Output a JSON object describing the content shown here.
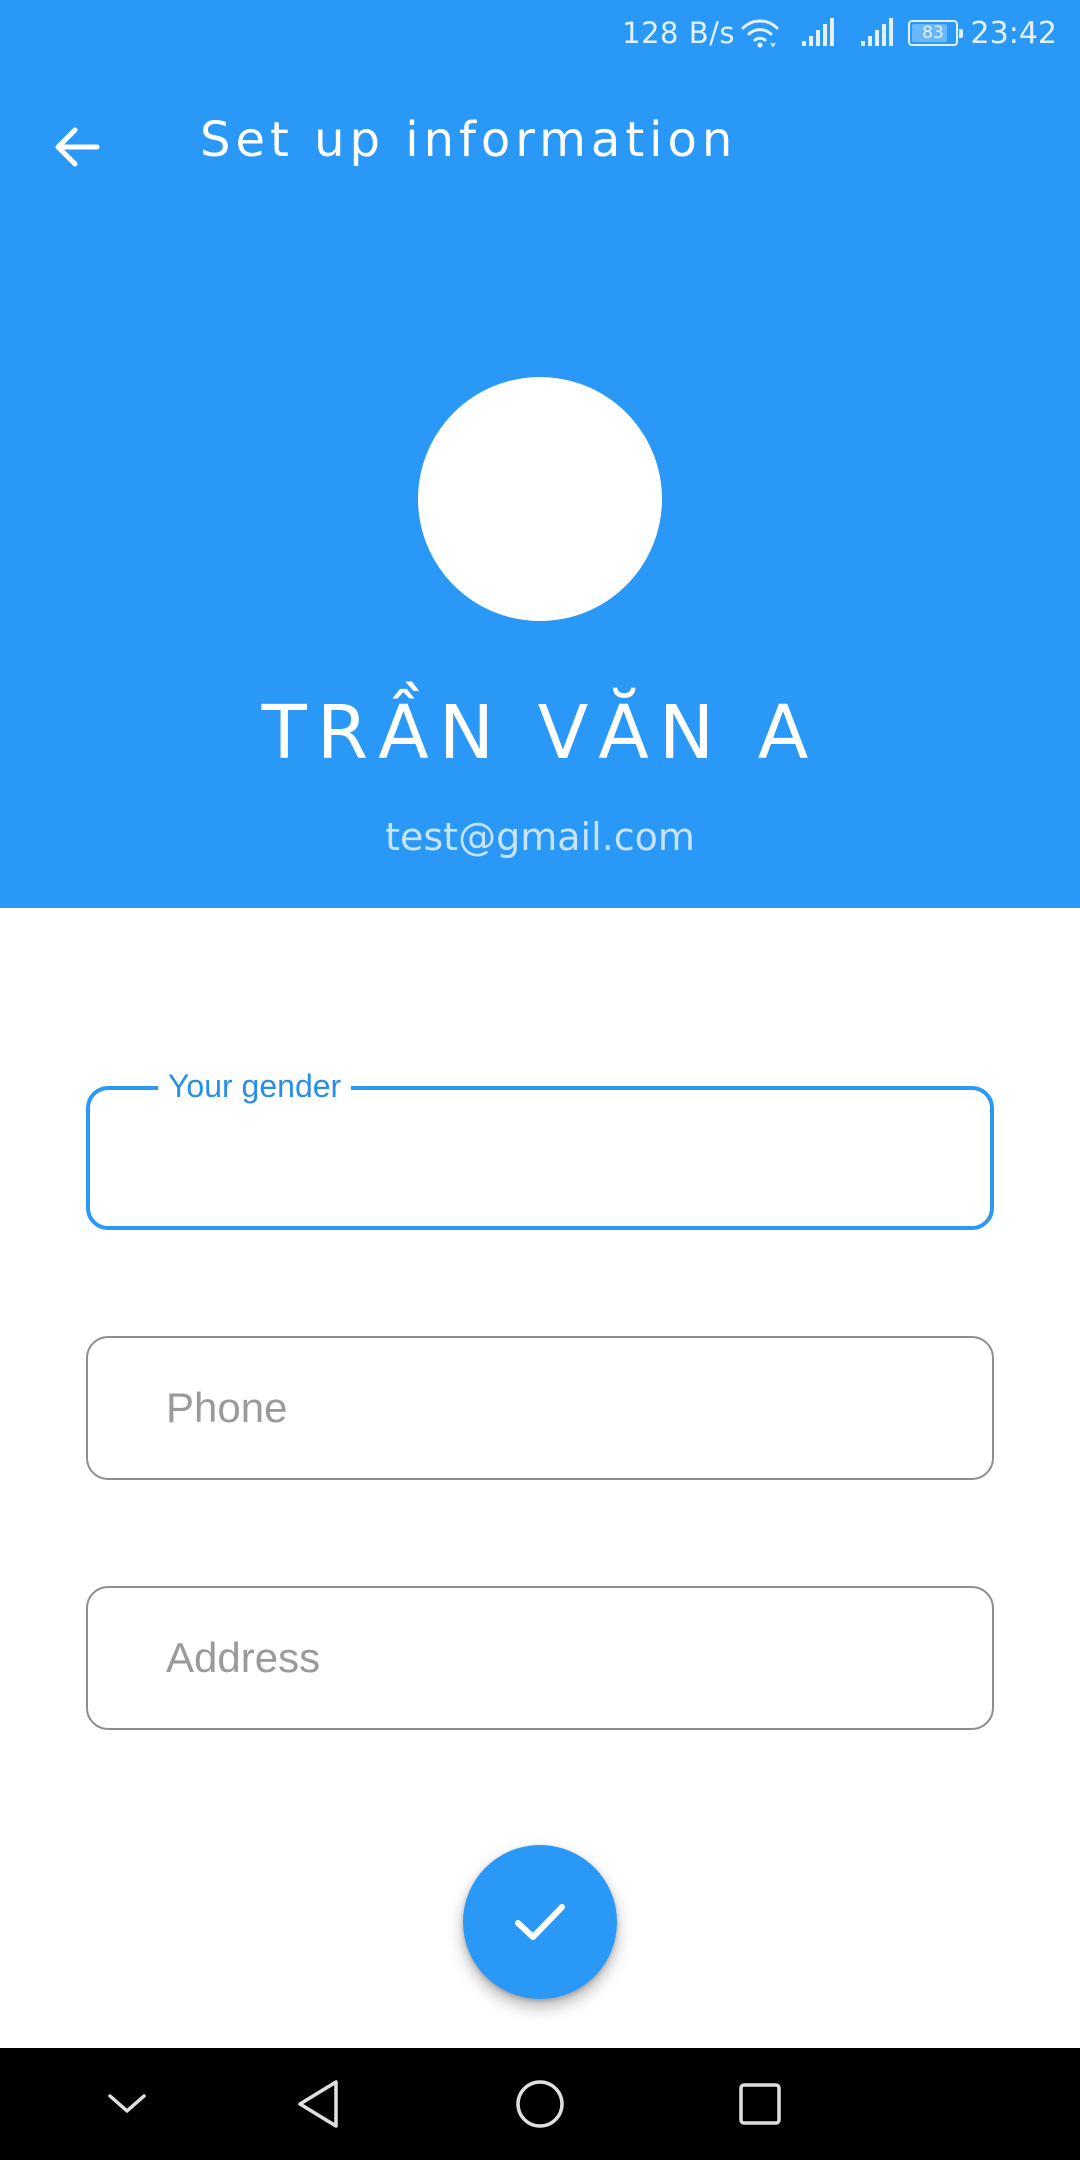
{
  "status_bar": {
    "network_speed": "128 B/s",
    "battery_level": "83",
    "time": "23:42"
  },
  "header": {
    "title": "Set up information",
    "back_icon": "arrow-left-icon"
  },
  "profile": {
    "name": "TRẦN VĂN A",
    "email": "test@gmail.com"
  },
  "form": {
    "gender": {
      "label": "Your gender",
      "value": ""
    },
    "phone": {
      "placeholder": "Phone",
      "value": ""
    },
    "address": {
      "placeholder": "Address",
      "value": ""
    }
  },
  "fab": {
    "icon": "check-icon"
  },
  "nav_bar": {
    "icons": [
      "chevron-down-icon",
      "back-triangle-icon",
      "home-circle-icon",
      "recents-square-icon"
    ]
  },
  "colors": {
    "primary": "#2a98f7",
    "label_focus": "#2a8ee8",
    "field_border": "#8e8e8e",
    "placeholder": "#9a9a9a",
    "nav_background": "#000000"
  }
}
